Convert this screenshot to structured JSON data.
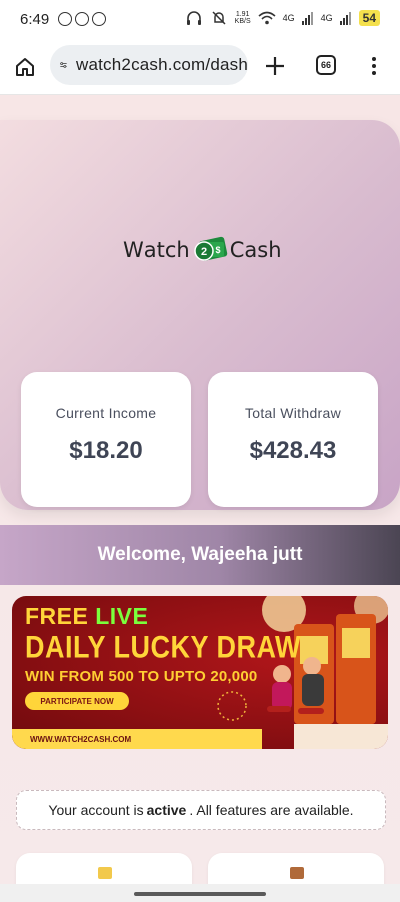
{
  "status_bar": {
    "time": "6:49",
    "speed_value": "1.91",
    "speed_unit": "KB/S",
    "net1": "4G",
    "net2": "4G",
    "battery": "54"
  },
  "browser": {
    "url": "watch2cash.com/dash",
    "tab_count": "66"
  },
  "logo": {
    "left_text": "W",
    "mid_text": "atch",
    "badge": "2",
    "right_text": "Cash"
  },
  "cards": [
    {
      "label": "Current Income",
      "value": "$18.20"
    },
    {
      "label": "Total Withdraw",
      "value": "$428.43"
    }
  ],
  "welcome": "Welcome, Wajeeha jutt",
  "banner": {
    "free": "FREE",
    "live": "LIVE",
    "headline": "DAILY LUCKY DRAW",
    "subhead": "WIN FROM 500 TO UPTO 20,000",
    "button": "PARTICIPATE NOW",
    "footer": "WWW.WATCH2CASH.COM"
  },
  "account_status": {
    "prefix": "Your account is",
    "state": "active",
    "suffix": ". All features are available."
  },
  "tiles": [
    {
      "icon": "credit-card-icon",
      "color": "#f2c94c"
    },
    {
      "icon": "briefcase-icon",
      "color": "#b06a3a"
    }
  ],
  "colors": {
    "accent": "#3f4555",
    "banner_red": "#8a0f12",
    "banner_yellow": "#ffd53a",
    "live_green": "#7bff3c"
  }
}
